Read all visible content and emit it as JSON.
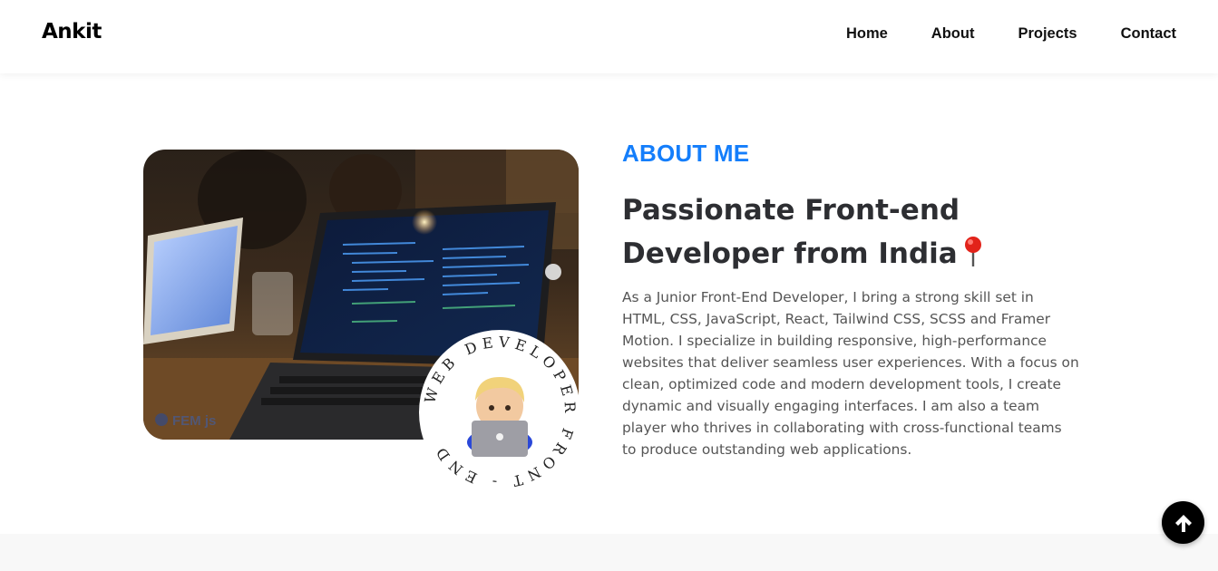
{
  "header": {
    "logo": "Ankit",
    "nav": [
      {
        "label": "Home"
      },
      {
        "label": "About"
      },
      {
        "label": "Projects"
      },
      {
        "label": "Contact"
      }
    ]
  },
  "about": {
    "section_label": "ABOUT ME",
    "headline": "Passionate Front-end Developer from India",
    "bio": "As a Junior Front-End Developer, I bring a strong skill set in HTML, CSS, JavaScript, React, Tailwind CSS, SCSS and Framer Motion. I specialize in building responsive, high-performance websites that deliver seamless user experiences. With a focus on clean, optimized code and modern development tools, I create dynamic and visually engaging interfaces. I am also a team player who thrives in collaborating with cross-functional teams to produce outstanding web applications.",
    "badge_text": "WEB DEVELOPER FRONT - END",
    "photo_watermark": "FEM js"
  },
  "colors": {
    "accent": "#147efb",
    "heading": "#2d2e32",
    "body_text": "#555555"
  },
  "icons": {
    "headline_icon": "round-pushpin-icon",
    "scroll_button_icon": "arrow-up-icon"
  }
}
